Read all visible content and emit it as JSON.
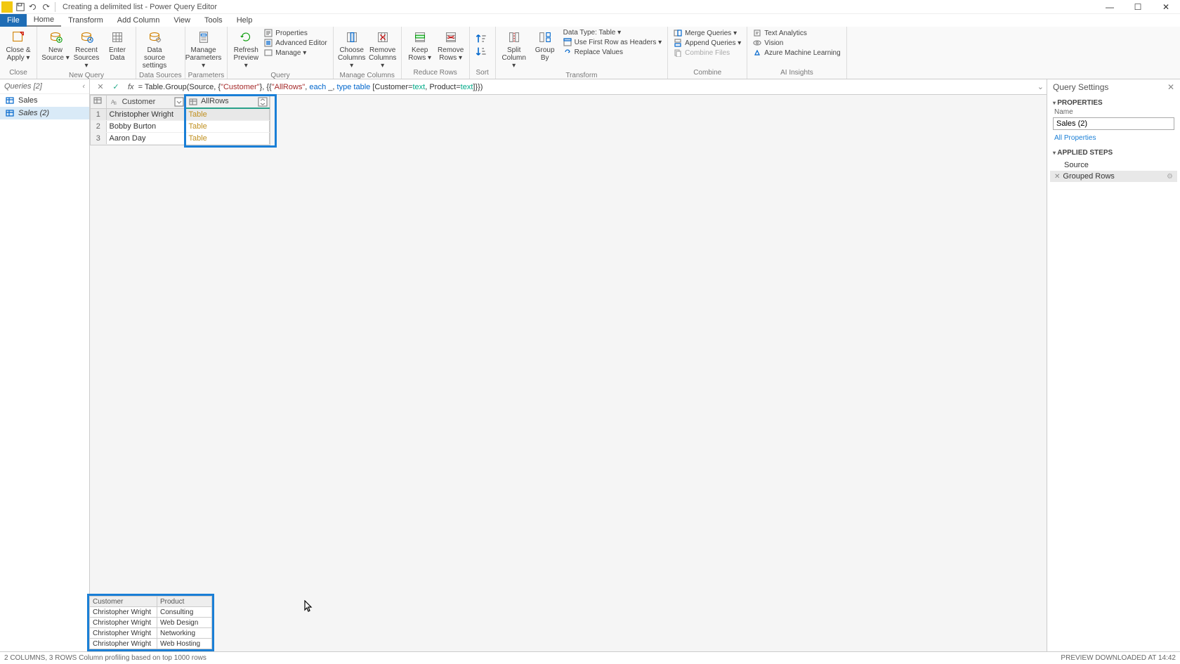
{
  "window": {
    "title": "Creating a delimited list - Power Query Editor"
  },
  "menu": {
    "file": "File",
    "tabs": [
      "Home",
      "Transform",
      "Add Column",
      "View",
      "Tools",
      "Help"
    ],
    "active": "Home"
  },
  "ribbon": {
    "close": {
      "label": "Close &\nApply ▾",
      "group": "Close"
    },
    "newquery": {
      "new_source": "New\nSource ▾",
      "recent_sources": "Recent\nSources ▾",
      "enter_data": "Enter\nData",
      "group": "New Query"
    },
    "datasources": {
      "btn": "Data source\nsettings",
      "group": "Data Sources"
    },
    "parameters": {
      "btn": "Manage\nParameters ▾",
      "group": "Parameters"
    },
    "query": {
      "refresh": "Refresh\nPreview ▾",
      "properties": "Properties",
      "advanced": "Advanced Editor",
      "manage": "Manage ▾",
      "group": "Query"
    },
    "managecols": {
      "choose": "Choose\nColumns ▾",
      "remove": "Remove\nColumns ▾",
      "group": "Manage Columns"
    },
    "reducerows": {
      "keep": "Keep\nRows ▾",
      "remove": "Remove\nRows ▾",
      "group": "Reduce Rows"
    },
    "sort": {
      "group": "Sort"
    },
    "transform": {
      "split": "Split\nColumn ▾",
      "groupby": "Group\nBy",
      "datatype": "Data Type: Table ▾",
      "firstrow": "Use First Row as Headers ▾",
      "replace": "Replace Values",
      "group": "Transform"
    },
    "combine": {
      "merge": "Merge Queries ▾",
      "append": "Append Queries ▾",
      "combinefiles": "Combine Files",
      "group": "Combine"
    },
    "ai": {
      "text": "Text Analytics",
      "vision": "Vision",
      "ml": "Azure Machine Learning",
      "group": "AI Insights"
    }
  },
  "queries": {
    "header": "Queries [2]",
    "items": [
      {
        "name": "Sales",
        "selected": false
      },
      {
        "name": "Sales (2)",
        "selected": true
      }
    ]
  },
  "formula": {
    "prefix": "= Table.Group(Source, {",
    "str1": "\"Customer\"",
    "mid1": "}, {{",
    "str2": "\"AllRows\"",
    "mid2": ", ",
    "kw_each": "each",
    "mid3": " _, ",
    "kw_type": "type",
    "mid4": " ",
    "kw_table": "table",
    "mid5": " [Customer=",
    "kw_text1": "text",
    "mid6": ", Product=",
    "kw_text2": "text",
    "suffix": "]}})"
  },
  "grid": {
    "columns": [
      "Customer",
      "AllRows"
    ],
    "rows": [
      {
        "n": 1,
        "customer": "Christopher Wright",
        "allrows": "Table"
      },
      {
        "n": 2,
        "customer": "Bobby Burton",
        "allrows": "Table"
      },
      {
        "n": 3,
        "customer": "Aaron Day",
        "allrows": "Table"
      }
    ]
  },
  "preview": {
    "columns": [
      "Customer",
      "Product"
    ],
    "rows": [
      [
        "Christopher Wright",
        "Consulting"
      ],
      [
        "Christopher Wright",
        "Web Design"
      ],
      [
        "Christopher Wright",
        "Networking"
      ],
      [
        "Christopher Wright",
        "Web Hosting"
      ]
    ]
  },
  "settings": {
    "title": "Query Settings",
    "properties_label": "PROPERTIES",
    "name_label": "Name",
    "name_value": "Sales (2)",
    "all_props": "All Properties",
    "steps_label": "APPLIED STEPS",
    "steps": [
      {
        "name": "Source",
        "selected": false
      },
      {
        "name": "Grouped Rows",
        "selected": true
      }
    ]
  },
  "status": {
    "left": "2 COLUMNS, 3 ROWS    Column profiling based on top 1000 rows",
    "right": "PREVIEW DOWNLOADED AT 14:42"
  }
}
